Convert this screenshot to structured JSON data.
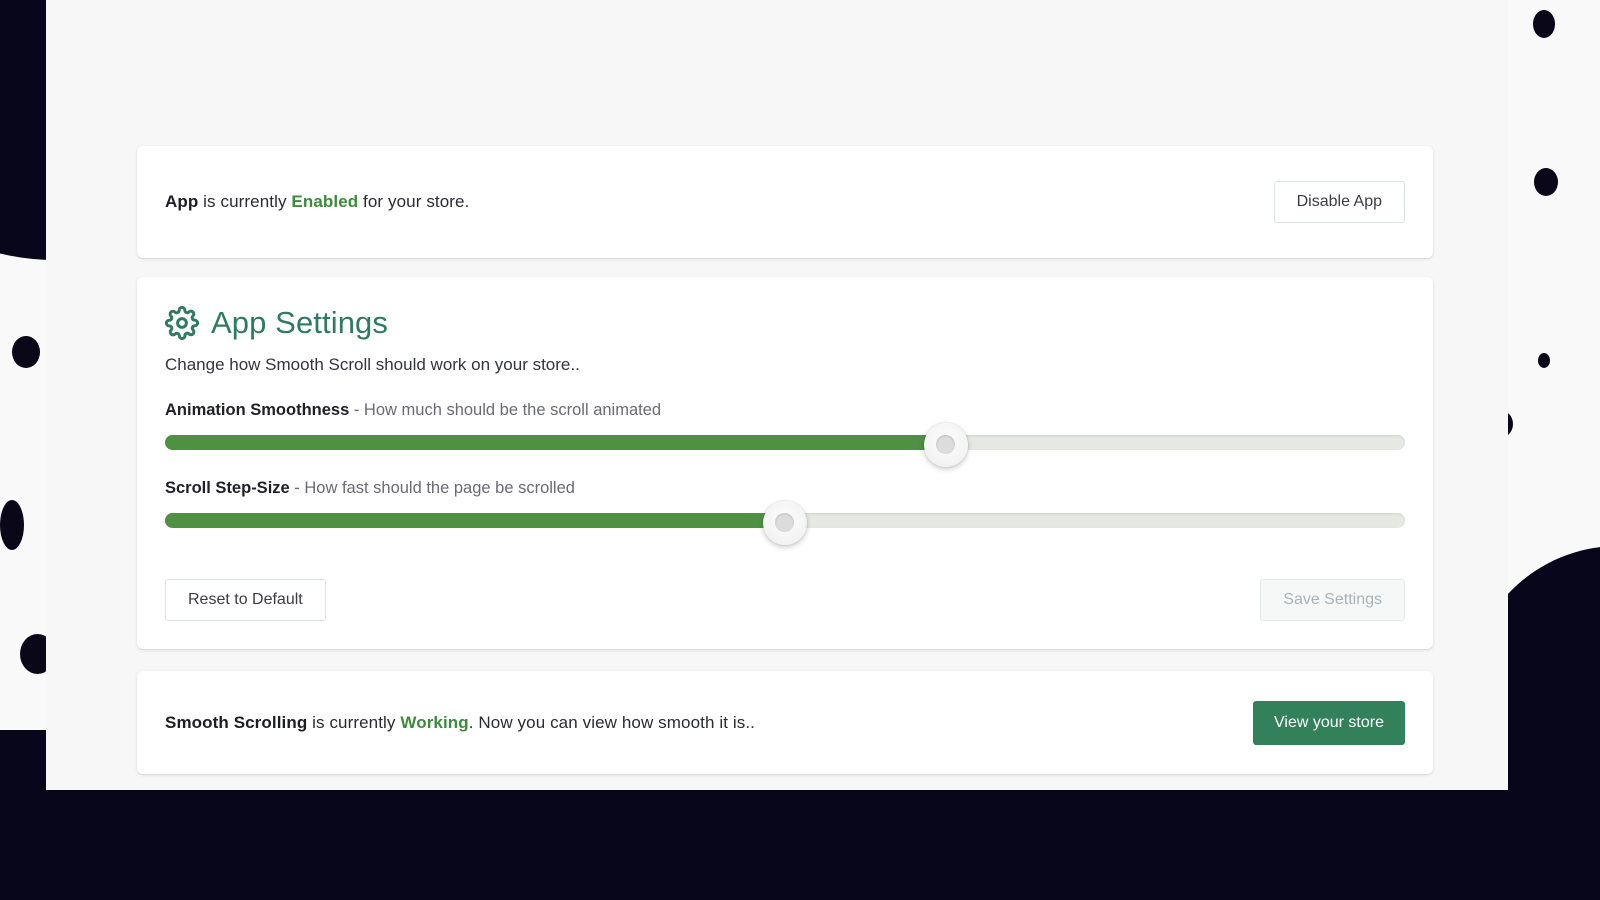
{
  "theme": {
    "page_background": "#f7f7f7",
    "card_background": "#ffffff",
    "accent_teal": "#2f7a63",
    "accent_green": "#33815a",
    "slider_fill": "#4f9143",
    "slider_track": "#e6e8e4",
    "status_green": "#3c8c3c",
    "decoration_dark": "#07061a"
  },
  "status_card": {
    "text_lead": "App",
    "text_middle": " is currently ",
    "status_word": "Enabled",
    "text_tail": " for your store.",
    "button_label": "Disable App"
  },
  "settings_card": {
    "icon": "gear-icon",
    "title": "App Settings",
    "subtitle": "Change how Smooth Scroll should work on your store..",
    "sliders": [
      {
        "name": "animation-smoothness",
        "label_bold": "Animation Smoothness",
        "label_rest": " - How much should be the scroll animated",
        "value_percent": 63,
        "min": 0,
        "max": 100
      },
      {
        "name": "scroll-step-size",
        "label_bold": "Scroll Step-Size",
        "label_rest": " - How fast should the page be scrolled",
        "value_percent": 50,
        "min": 0,
        "max": 100
      }
    ],
    "reset_button_label": "Reset to Default",
    "save_button_label": "Save Settings",
    "save_button_disabled": true
  },
  "scrolling_card": {
    "text_lead": "Smooth Scrolling",
    "text_middle": " is currently ",
    "status_word": "Working",
    "text_tail": ". Now you can view how smooth it is..",
    "button_label": "View your store"
  }
}
